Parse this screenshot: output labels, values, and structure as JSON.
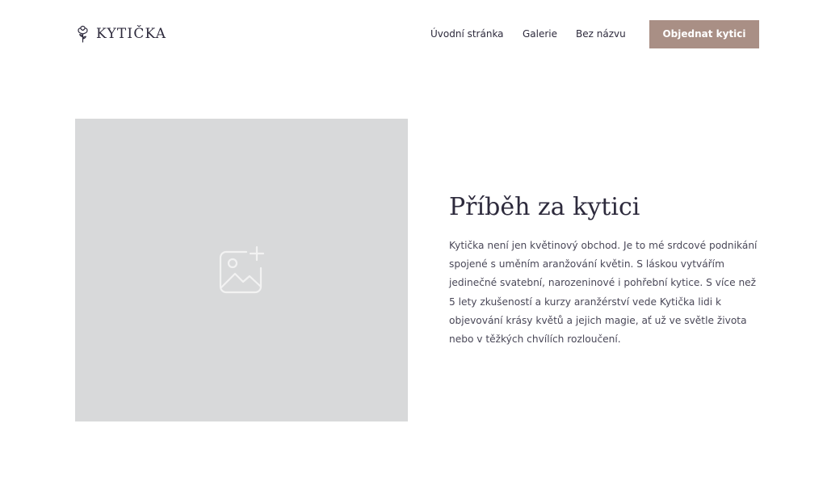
{
  "brand": {
    "name": "KYTIČKA",
    "icon": "rose-icon"
  },
  "nav": {
    "items": [
      {
        "label": "Úvodní stránka"
      },
      {
        "label": "Galerie"
      },
      {
        "label": "Bez názvu"
      }
    ],
    "cta_label": "Objednat kytici"
  },
  "hero": {
    "image_icon": "image-add-icon"
  },
  "story": {
    "title": "Příběh za kytici",
    "text": "Kytička není jen květinový obchod. Je to mé srdcové podnikání spojené s uměním aranžování květin. S láskou vytvářím jedinečné svatební, narozeninové i pohřební kytice. S více než 5 lety zkušeností a kurzy aranžérství vede Kytička lidi k objevování krásy květů a jejich magie, ať už ve světle života nebo v těžkých chvílích rozloučení."
  },
  "colors": {
    "accent": "#a98f85",
    "text_dark": "#2d2a3c",
    "placeholder_bg": "#d8d9da"
  }
}
